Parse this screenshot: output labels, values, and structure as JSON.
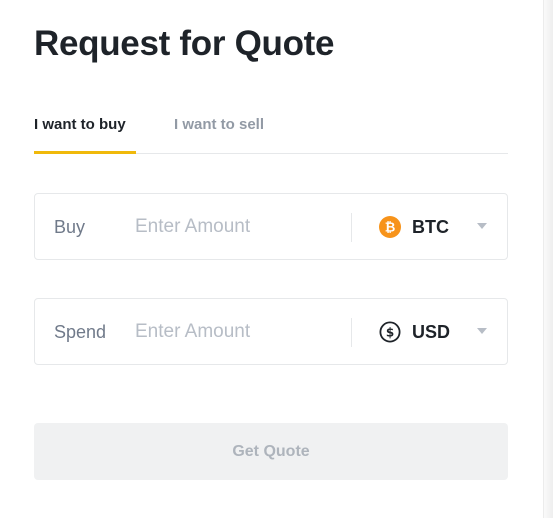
{
  "title": "Request for Quote",
  "tabs": [
    {
      "label": "I want to buy",
      "active": true
    },
    {
      "label": "I want to sell",
      "active": false
    }
  ],
  "buy_field": {
    "label": "Buy",
    "value": "",
    "placeholder": "Enter Amount",
    "currency": "BTC",
    "icon": "bitcoin-icon"
  },
  "spend_field": {
    "label": "Spend",
    "value": "",
    "placeholder": "Enter Amount",
    "currency": "USD",
    "icon": "dollar-icon"
  },
  "button": {
    "label": "Get Quote"
  },
  "colors": {
    "accent": "#f0b90b",
    "bitcoin": "#f7931a",
    "text": "#1e2329",
    "muted": "#929aa5",
    "placeholder": "#b7bdc6",
    "button_bg": "#f0f1f2",
    "button_text": "#aeb4bc"
  }
}
